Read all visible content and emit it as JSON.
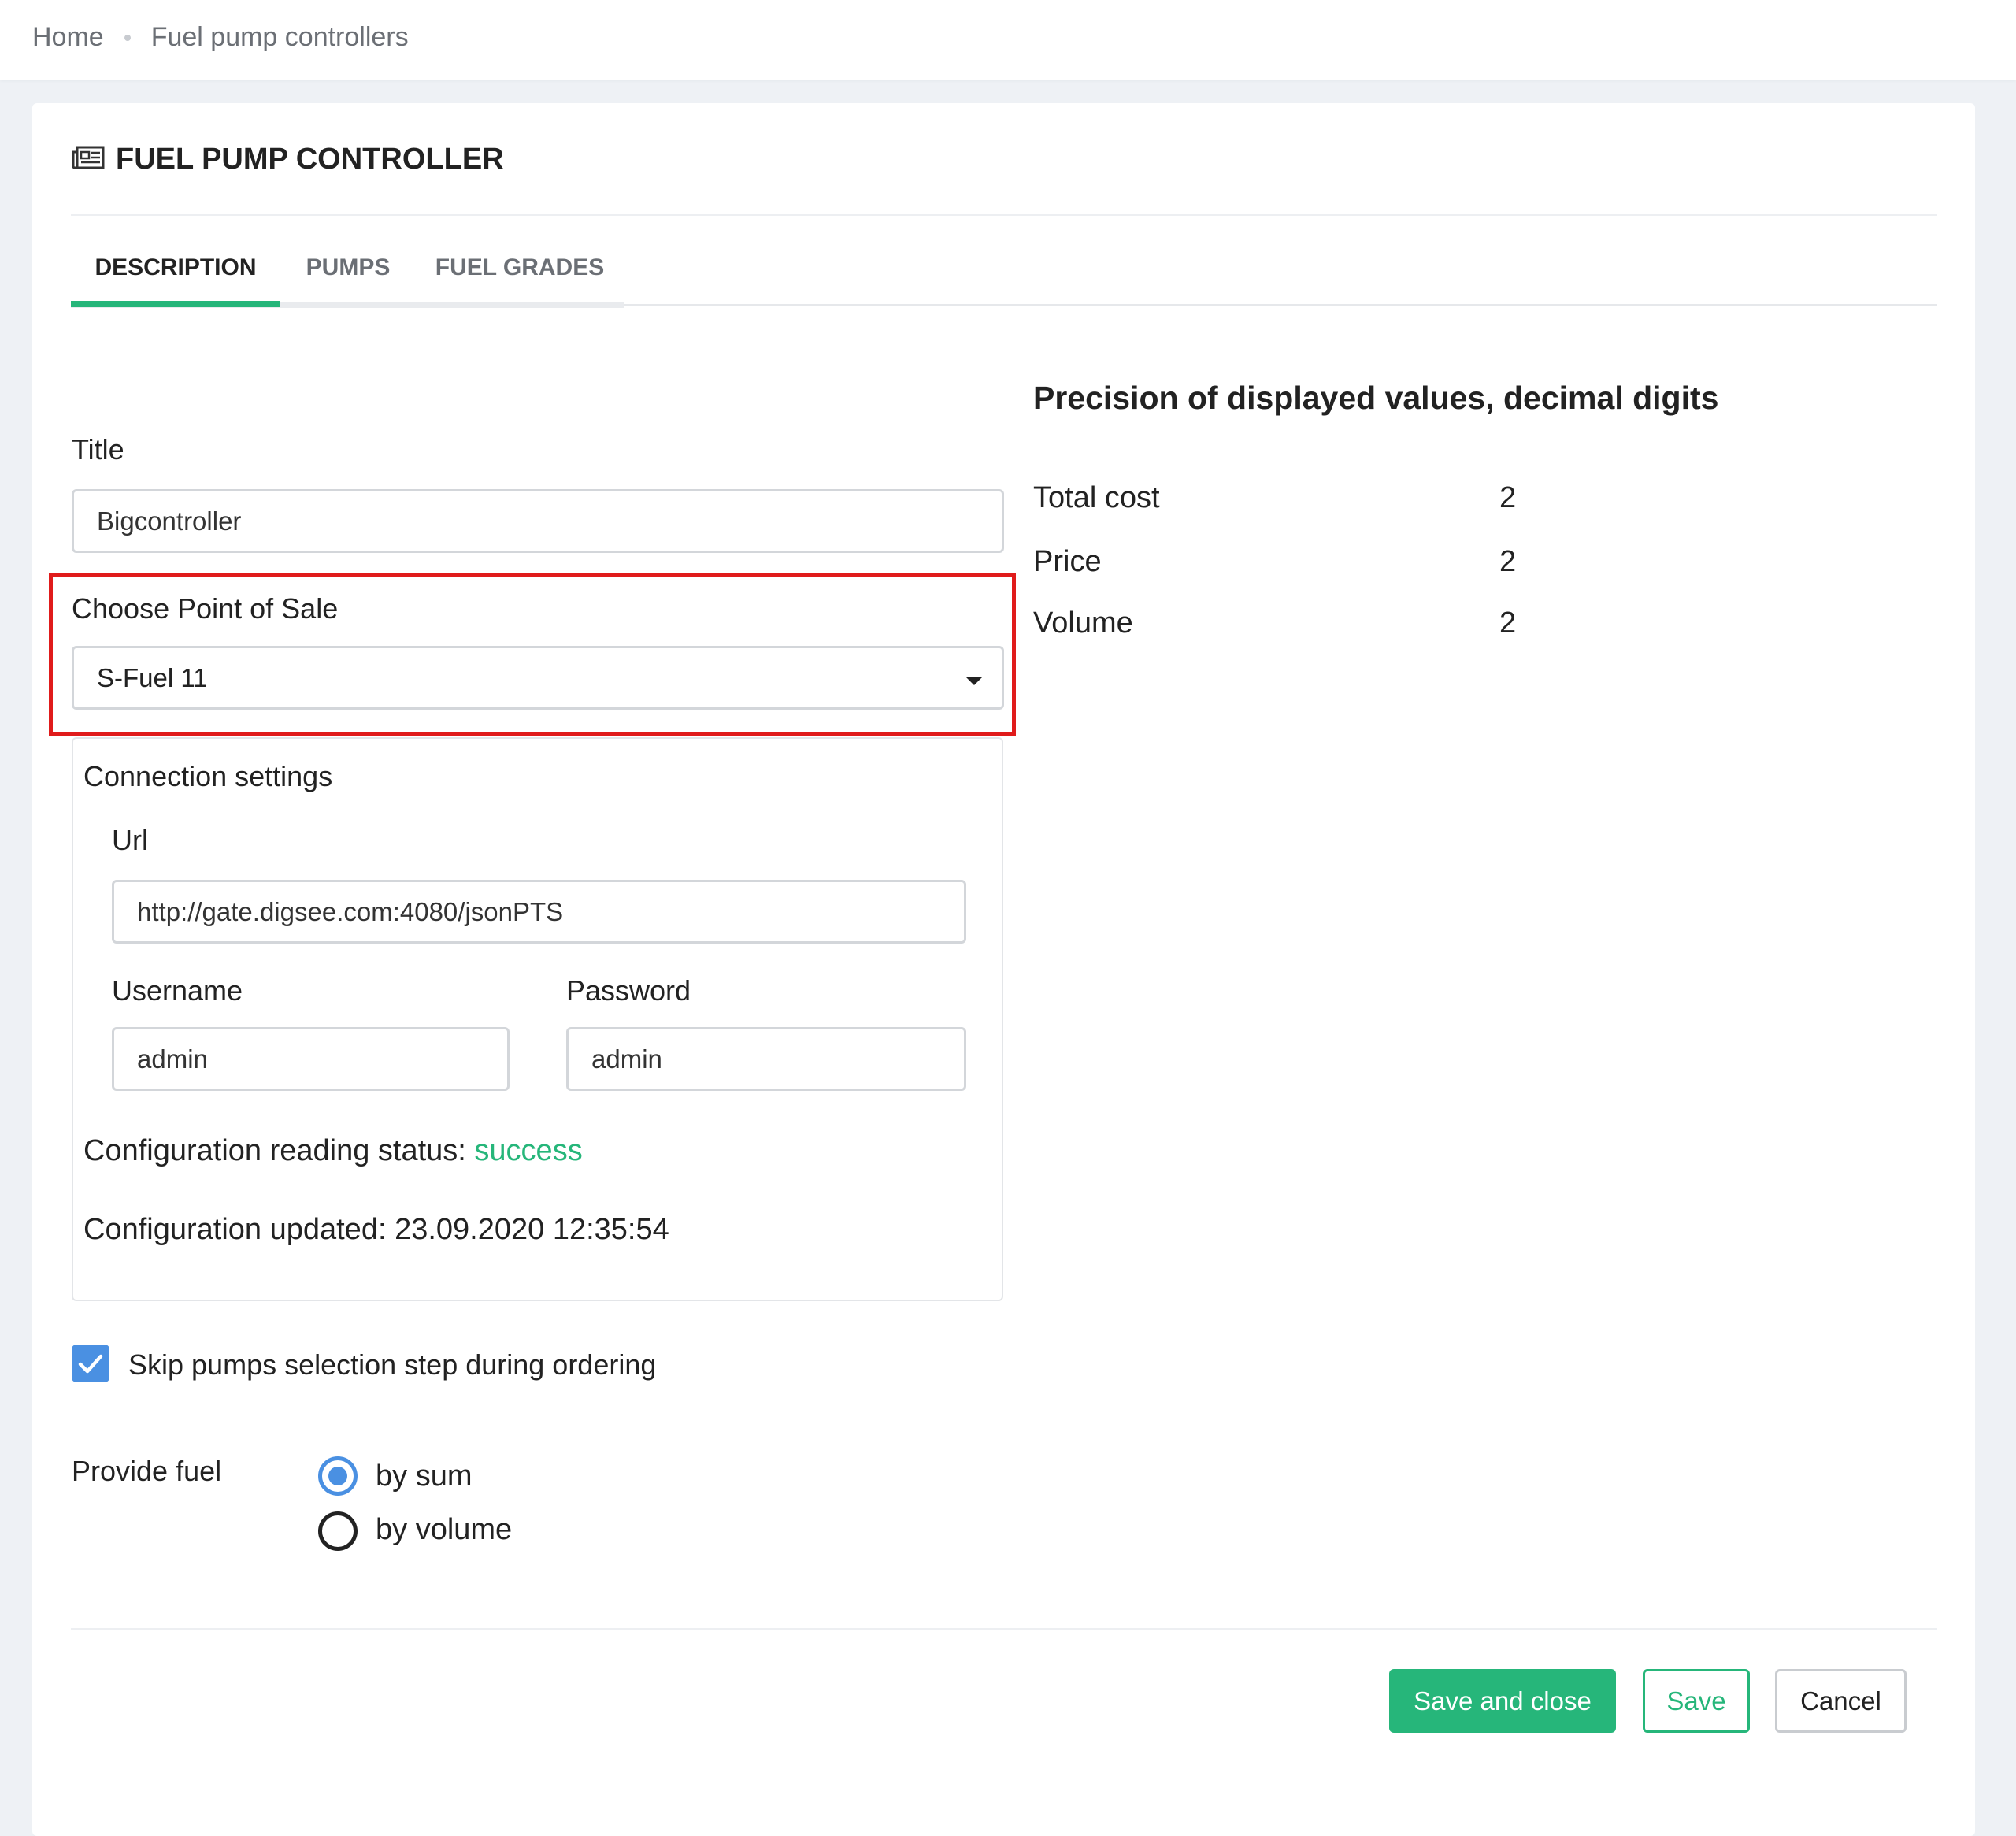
{
  "breadcrumb": {
    "home": "Home",
    "current": "Fuel pump controllers"
  },
  "header": {
    "icon": "newspaper-icon",
    "title": "FUEL PUMP CONTROLLER"
  },
  "tabs": [
    {
      "label": "DESCRIPTION",
      "active": true
    },
    {
      "label": "PUMPS",
      "active": false
    },
    {
      "label": "FUEL GRADES",
      "active": false
    }
  ],
  "form": {
    "title_label": "Title",
    "title_value": "Bigcontroller",
    "pos_label": "Choose Point of Sale",
    "pos_value": "S-Fuel 11",
    "connection": {
      "heading": "Connection settings",
      "url_label": "Url",
      "url_value": "http://gate.digsee.com:4080/jsonPTS",
      "username_label": "Username",
      "username_value": "admin",
      "password_label": "Password",
      "password_value": "admin",
      "status_label": "Configuration reading status:",
      "status_value": "success",
      "updated_label": "Configuration updated:",
      "updated_value": "23.09.2020 12:35:54"
    },
    "skip_pumps": {
      "label": "Skip pumps selection step during ordering",
      "checked": true
    },
    "provide_fuel": {
      "label": "Provide fuel",
      "options": [
        {
          "label": "by sum",
          "checked": true
        },
        {
          "label": "by volume",
          "checked": false
        }
      ]
    }
  },
  "precision": {
    "title": "Precision of displayed values, decimal digits",
    "rows": [
      {
        "label": "Total cost",
        "value": "2"
      },
      {
        "label": "Price",
        "value": "2"
      },
      {
        "label": "Volume",
        "value": "2"
      }
    ]
  },
  "actions": {
    "save_and_close": "Save and close",
    "save": "Save",
    "cancel": "Cancel"
  },
  "colors": {
    "accent": "#26b67a",
    "checkbox": "#4a90e2",
    "highlight": "#e01b1b",
    "success_text": "#26b67a"
  }
}
